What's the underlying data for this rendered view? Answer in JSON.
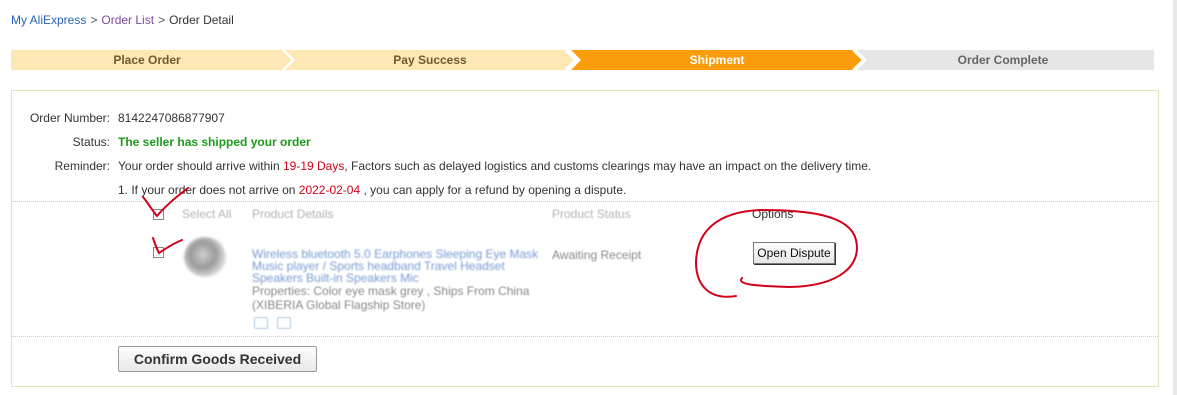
{
  "breadcrumb": {
    "items": [
      "My AliExpress",
      "Order List",
      "Order Detail"
    ],
    "separator": ">"
  },
  "steps": {
    "items": [
      "Place Order",
      "Pay Success",
      "Shipment",
      "Order Complete"
    ],
    "active_index": 2,
    "colors": {
      "done": "#fce7b5",
      "active": "#fb9c0c",
      "todo": "#e6e6e6"
    }
  },
  "order": {
    "number_label": "Order Number:",
    "number": "8142247086877907",
    "status_label": "Status:",
    "status": "The seller has shipped your order",
    "reminder_label": "Reminder:",
    "reminder_pre": "Your order should arrive within ",
    "reminder_days": "19-19 Days",
    "reminder_post": ", Factors such as delayed logistics and customs clearings may have an impact on the delivery time.",
    "refund_pre": "1. If your order does not arrive on ",
    "refund_date": "2022-02-04",
    "refund_post": " , you can apply for a refund by opening a dispute."
  },
  "table": {
    "headers": {
      "select_all": "Select All",
      "product_details": "Product Details",
      "product_status": "Product Status",
      "options": "Options"
    },
    "rows": [
      {
        "title": "Wireless bluetooth 5.0 Earphones Sleeping Eye Mask Music player / Sports headband Travel Headset Speakers Built-in Speakers Mic",
        "properties": "Properties: Color eye mask grey    , Ships From China",
        "store": "(XIBERIA Global Flagship Store)",
        "status": "Awaiting Receipt",
        "action": "Open Dispute"
      }
    ]
  },
  "actions": {
    "confirm": "Confirm Goods Received"
  },
  "annotation_color": "#d0021b"
}
